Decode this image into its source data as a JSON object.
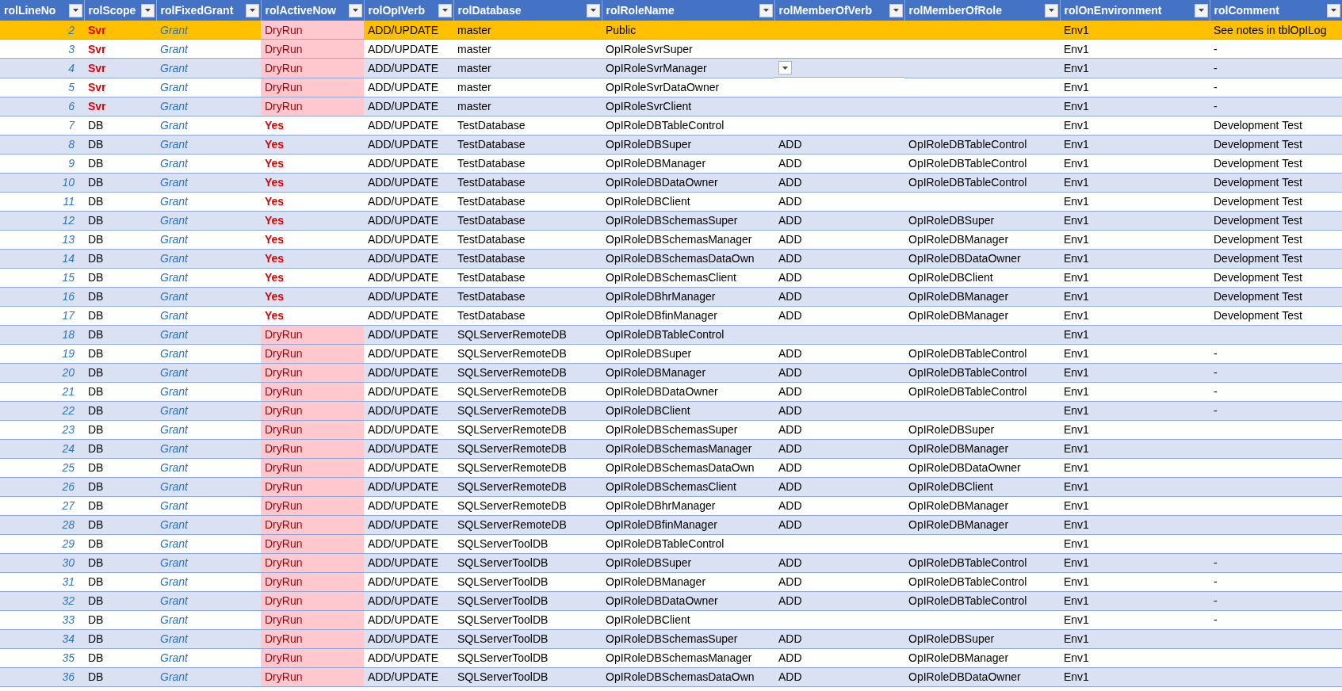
{
  "table": {
    "columns": [
      "rolLineNo",
      "rolScope",
      "rolFixedGrant",
      "rolActiveNow",
      "rolOpIVerb",
      "rolDatabase",
      "rolRoleName",
      "rolMemberOfVerb",
      "rolMemberOfRole",
      "rolOnEnvironment",
      "rolComment"
    ],
    "rows": [
      {
        "line_no": "2",
        "scope": "Svr",
        "scope_emphasis": true,
        "fixed_grant": "Grant",
        "active_now": "DryRun",
        "dry_run": true,
        "opi_verb": "ADD/UPDATE",
        "database": "master",
        "role_name": "Public",
        "on_environment": "Env1",
        "comment": "See notes in tblOpILog",
        "selected": true
      },
      {
        "line_no": "3",
        "scope": "Svr",
        "scope_emphasis": true,
        "fixed_grant": "Grant",
        "active_now": "DryRun",
        "dry_run": true,
        "opi_verb": "ADD/UPDATE",
        "database": "master",
        "role_name": "OpIRoleSvrSuper",
        "on_environment": "Env1",
        "comment": "-",
        "selected": false
      },
      {
        "line_no": "4",
        "scope": "Svr",
        "scope_emphasis": true,
        "fixed_grant": "Grant",
        "active_now": "DryRun",
        "dry_run": true,
        "opi_verb": "ADD/UPDATE",
        "database": "master",
        "role_name": "OpIRoleSvrManager",
        "dropdown_shown": true,
        "on_environment": "Env1",
        "comment": "-",
        "selected": false
      },
      {
        "line_no": "5",
        "scope": "Svr",
        "scope_emphasis": true,
        "fixed_grant": "Grant",
        "active_now": "DryRun",
        "dry_run": true,
        "opi_verb": "ADD/UPDATE",
        "database": "master",
        "role_name": "OpIRoleSvrDataOwner",
        "on_environment": "Env1",
        "comment": "-",
        "selected": false
      },
      {
        "line_no": "6",
        "scope": "Svr",
        "scope_emphasis": true,
        "fixed_grant": "Grant",
        "active_now": "DryRun",
        "dry_run": true,
        "opi_verb": "ADD/UPDATE",
        "database": "master",
        "role_name": "OpIRoleSvrClient",
        "on_environment": "Env1",
        "comment": "-",
        "selected": false
      },
      {
        "line_no": "7",
        "scope": "DB",
        "scope_emphasis": false,
        "fixed_grant": "Grant",
        "active_now": "Yes",
        "dry_run": false,
        "opi_verb": "ADD/UPDATE",
        "database": "TestDatabase",
        "role_name": "OpIRoleDBTableControl",
        "on_environment": "Env1",
        "comment": "Development Test",
        "selected": false
      },
      {
        "line_no": "8",
        "scope": "DB",
        "scope_emphasis": false,
        "fixed_grant": "Grant",
        "active_now": "Yes",
        "dry_run": false,
        "opi_verb": "ADD/UPDATE",
        "database": "TestDatabase",
        "role_name": "OpIRoleDBSuper",
        "member_of_verb": "ADD",
        "member_of_role": "OpIRoleDBTableControl",
        "on_environment": "Env1",
        "comment": "Development Test",
        "selected": false
      },
      {
        "line_no": "9",
        "scope": "DB",
        "scope_emphasis": false,
        "fixed_grant": "Grant",
        "active_now": "Yes",
        "dry_run": false,
        "opi_verb": "ADD/UPDATE",
        "database": "TestDatabase",
        "role_name": "OpIRoleDBManager",
        "member_of_verb": "ADD",
        "member_of_role": "OpIRoleDBTableControl",
        "on_environment": "Env1",
        "comment": "Development Test",
        "selected": false
      },
      {
        "line_no": "10",
        "scope": "DB",
        "scope_emphasis": false,
        "fixed_grant": "Grant",
        "active_now": "Yes",
        "dry_run": false,
        "opi_verb": "ADD/UPDATE",
        "database": "TestDatabase",
        "role_name": "OpIRoleDBDataOwner",
        "member_of_verb": "ADD",
        "member_of_role": "OpIRoleDBTableControl",
        "on_environment": "Env1",
        "comment": "Development Test",
        "selected": false
      },
      {
        "line_no": "11",
        "scope": "DB",
        "scope_emphasis": false,
        "fixed_grant": "Grant",
        "active_now": "Yes",
        "dry_run": false,
        "opi_verb": "ADD/UPDATE",
        "database": "TestDatabase",
        "role_name": "OpIRoleDBClient",
        "member_of_verb": "ADD",
        "on_environment": "Env1",
        "comment": "Development Test",
        "selected": false
      },
      {
        "line_no": "12",
        "scope": "DB",
        "scope_emphasis": false,
        "fixed_grant": "Grant",
        "active_now": "Yes",
        "dry_run": false,
        "opi_verb": "ADD/UPDATE",
        "database": "TestDatabase",
        "role_name": "OpIRoleDBSchemasSuper",
        "member_of_verb": "ADD",
        "member_of_role": "OpIRoleDBSuper",
        "on_environment": "Env1",
        "comment": "Development Test",
        "selected": false
      },
      {
        "line_no": "13",
        "scope": "DB",
        "scope_emphasis": false,
        "fixed_grant": "Grant",
        "active_now": "Yes",
        "dry_run": false,
        "opi_verb": "ADD/UPDATE",
        "database": "TestDatabase",
        "role_name": "OpIRoleDBSchemasManager",
        "member_of_verb": "ADD",
        "member_of_role": "OpIRoleDBManager",
        "on_environment": "Env1",
        "comment": "Development Test",
        "selected": false
      },
      {
        "line_no": "14",
        "scope": "DB",
        "scope_emphasis": false,
        "fixed_grant": "Grant",
        "active_now": "Yes",
        "dry_run": false,
        "opi_verb": "ADD/UPDATE",
        "database": "TestDatabase",
        "role_name": "OpIRoleDBSchemasDataOwn",
        "member_of_verb": "ADD",
        "member_of_role": "OpIRoleDBDataOwner",
        "on_environment": "Env1",
        "comment": "Development Test",
        "selected": false
      },
      {
        "line_no": "15",
        "scope": "DB",
        "scope_emphasis": false,
        "fixed_grant": "Grant",
        "active_now": "Yes",
        "dry_run": false,
        "opi_verb": "ADD/UPDATE",
        "database": "TestDatabase",
        "role_name": "OpIRoleDBSchemasClient",
        "member_of_verb": "ADD",
        "member_of_role": "OpIRoleDBClient",
        "on_environment": "Env1",
        "comment": "Development Test",
        "selected": false
      },
      {
        "line_no": "16",
        "scope": "DB",
        "scope_emphasis": false,
        "fixed_grant": "Grant",
        "active_now": "Yes",
        "dry_run": false,
        "opi_verb": "ADD/UPDATE",
        "database": "TestDatabase",
        "role_name": "OpIRoleDBhrManager",
        "member_of_verb": "ADD",
        "member_of_role": "OpIRoleDBManager",
        "on_environment": "Env1",
        "comment": "Development Test",
        "selected": false
      },
      {
        "line_no": "17",
        "scope": "DB",
        "scope_emphasis": false,
        "fixed_grant": "Grant",
        "active_now": "Yes",
        "dry_run": false,
        "opi_verb": "ADD/UPDATE",
        "database": "TestDatabase",
        "role_name": "OpIRoleDBfinManager",
        "member_of_verb": "ADD",
        "member_of_role": "OpIRoleDBManager",
        "on_environment": "Env1",
        "comment": "Development Test",
        "selected": false
      },
      {
        "line_no": "18",
        "scope": "DB",
        "scope_emphasis": false,
        "fixed_grant": "Grant",
        "active_now": "DryRun",
        "dry_run": true,
        "opi_verb": "ADD/UPDATE",
        "database": "SQLServerRemoteDB",
        "role_name": "OpIRoleDBTableControl",
        "on_environment": "Env1",
        "selected": false
      },
      {
        "line_no": "19",
        "scope": "DB",
        "scope_emphasis": false,
        "fixed_grant": "Grant",
        "active_now": "DryRun",
        "dry_run": true,
        "opi_verb": "ADD/UPDATE",
        "database": "SQLServerRemoteDB",
        "role_name": "OpIRoleDBSuper",
        "member_of_verb": "ADD",
        "member_of_role": "OpIRoleDBTableControl",
        "on_environment": "Env1",
        "comment": "-",
        "selected": false
      },
      {
        "line_no": "20",
        "scope": "DB",
        "scope_emphasis": false,
        "fixed_grant": "Grant",
        "active_now": "DryRun",
        "dry_run": true,
        "opi_verb": "ADD/UPDATE",
        "database": "SQLServerRemoteDB",
        "role_name": "OpIRoleDBManager",
        "member_of_verb": "ADD",
        "member_of_role": "OpIRoleDBTableControl",
        "on_environment": "Env1",
        "comment": "-",
        "selected": false
      },
      {
        "line_no": "21",
        "scope": "DB",
        "scope_emphasis": false,
        "fixed_grant": "Grant",
        "active_now": "DryRun",
        "dry_run": true,
        "opi_verb": "ADD/UPDATE",
        "database": "SQLServerRemoteDB",
        "role_name": "OpIRoleDBDataOwner",
        "member_of_verb": "ADD",
        "member_of_role": "OpIRoleDBTableControl",
        "on_environment": "Env1",
        "comment": "-",
        "selected": false
      },
      {
        "line_no": "22",
        "scope": "DB",
        "scope_emphasis": false,
        "fixed_grant": "Grant",
        "active_now": "DryRun",
        "dry_run": true,
        "opi_verb": "ADD/UPDATE",
        "database": "SQLServerRemoteDB",
        "role_name": "OpIRoleDBClient",
        "member_of_verb": "ADD",
        "on_environment": "Env1",
        "comment": "-",
        "selected": false
      },
      {
        "line_no": "23",
        "scope": "DB",
        "scope_emphasis": false,
        "fixed_grant": "Grant",
        "active_now": "DryRun",
        "dry_run": true,
        "opi_verb": "ADD/UPDATE",
        "database": "SQLServerRemoteDB",
        "role_name": "OpIRoleDBSchemasSuper",
        "member_of_verb": "ADD",
        "member_of_role": "OpIRoleDBSuper",
        "on_environment": "Env1",
        "selected": false
      },
      {
        "line_no": "24",
        "scope": "DB",
        "scope_emphasis": false,
        "fixed_grant": "Grant",
        "active_now": "DryRun",
        "dry_run": true,
        "opi_verb": "ADD/UPDATE",
        "database": "SQLServerRemoteDB",
        "role_name": "OpIRoleDBSchemasManager",
        "member_of_verb": "ADD",
        "member_of_role": "OpIRoleDBManager",
        "on_environment": "Env1",
        "selected": false
      },
      {
        "line_no": "25",
        "scope": "DB",
        "scope_emphasis": false,
        "fixed_grant": "Grant",
        "active_now": "DryRun",
        "dry_run": true,
        "opi_verb": "ADD/UPDATE",
        "database": "SQLServerRemoteDB",
        "role_name": "OpIRoleDBSchemasDataOwn",
        "member_of_verb": "ADD",
        "member_of_role": "OpIRoleDBDataOwner",
        "on_environment": "Env1",
        "selected": false
      },
      {
        "line_no": "26",
        "scope": "DB",
        "scope_emphasis": false,
        "fixed_grant": "Grant",
        "active_now": "DryRun",
        "dry_run": true,
        "opi_verb": "ADD/UPDATE",
        "database": "SQLServerRemoteDB",
        "role_name": "OpIRoleDBSchemasClient",
        "member_of_verb": "ADD",
        "member_of_role": "OpIRoleDBClient",
        "on_environment": "Env1",
        "selected": false
      },
      {
        "line_no": "27",
        "scope": "DB",
        "scope_emphasis": false,
        "fixed_grant": "Grant",
        "active_now": "DryRun",
        "dry_run": true,
        "opi_verb": "ADD/UPDATE",
        "database": "SQLServerRemoteDB",
        "role_name": "OpIRoleDBhrManager",
        "member_of_verb": "ADD",
        "member_of_role": "OpIRoleDBManager",
        "on_environment": "Env1",
        "selected": false
      },
      {
        "line_no": "28",
        "scope": "DB",
        "scope_emphasis": false,
        "fixed_grant": "Grant",
        "active_now": "DryRun",
        "dry_run": true,
        "opi_verb": "ADD/UPDATE",
        "database": "SQLServerRemoteDB",
        "role_name": "OpIRoleDBfinManager",
        "member_of_verb": "ADD",
        "member_of_role": "OpIRoleDBManager",
        "on_environment": "Env1",
        "selected": false
      },
      {
        "line_no": "29",
        "scope": "DB",
        "scope_emphasis": false,
        "fixed_grant": "Grant",
        "active_now": "DryRun",
        "dry_run": true,
        "opi_verb": "ADD/UPDATE",
        "database": "SQLServerToolDB",
        "role_name": "OpIRoleDBTableControl",
        "on_environment": "Env1",
        "selected": false
      },
      {
        "line_no": "30",
        "scope": "DB",
        "scope_emphasis": false,
        "fixed_grant": "Grant",
        "active_now": "DryRun",
        "dry_run": true,
        "opi_verb": "ADD/UPDATE",
        "database": "SQLServerToolDB",
        "role_name": "OpIRoleDBSuper",
        "member_of_verb": "ADD",
        "member_of_role": "OpIRoleDBTableControl",
        "on_environment": "Env1",
        "comment": "-",
        "selected": false
      },
      {
        "line_no": "31",
        "scope": "DB",
        "scope_emphasis": false,
        "fixed_grant": "Grant",
        "active_now": "DryRun",
        "dry_run": true,
        "opi_verb": "ADD/UPDATE",
        "database": "SQLServerToolDB",
        "role_name": "OpIRoleDBManager",
        "member_of_verb": "ADD",
        "member_of_role": "OpIRoleDBTableControl",
        "on_environment": "Env1",
        "comment": "-",
        "selected": false
      },
      {
        "line_no": "32",
        "scope": "DB",
        "scope_emphasis": false,
        "fixed_grant": "Grant",
        "active_now": "DryRun",
        "dry_run": true,
        "opi_verb": "ADD/UPDATE",
        "database": "SQLServerToolDB",
        "role_name": "OpIRoleDBDataOwner",
        "member_of_verb": "ADD",
        "member_of_role": "OpIRoleDBTableControl",
        "on_environment": "Env1",
        "comment": "-",
        "selected": false
      },
      {
        "line_no": "33",
        "scope": "DB",
        "scope_emphasis": false,
        "fixed_grant": "Grant",
        "active_now": "DryRun",
        "dry_run": true,
        "opi_verb": "ADD/UPDATE",
        "database": "SQLServerToolDB",
        "role_name": "OpIRoleDBClient",
        "on_environment": "Env1",
        "comment": "-",
        "selected": false
      },
      {
        "line_no": "34",
        "scope": "DB",
        "scope_emphasis": false,
        "fixed_grant": "Grant",
        "active_now": "DryRun",
        "dry_run": true,
        "opi_verb": "ADD/UPDATE",
        "database": "SQLServerToolDB",
        "role_name": "OpIRoleDBSchemasSuper",
        "member_of_verb": "ADD",
        "member_of_role": "OpIRoleDBSuper",
        "on_environment": "Env1",
        "selected": false
      },
      {
        "line_no": "35",
        "scope": "DB",
        "scope_emphasis": false,
        "fixed_grant": "Grant",
        "active_now": "DryRun",
        "dry_run": true,
        "opi_verb": "ADD/UPDATE",
        "database": "SQLServerToolDB",
        "role_name": "OpIRoleDBSchemasManager",
        "member_of_verb": "ADD",
        "member_of_role": "OpIRoleDBManager",
        "on_environment": "Env1",
        "selected": false
      },
      {
        "line_no": "36",
        "scope": "DB",
        "scope_emphasis": false,
        "fixed_grant": "Grant",
        "active_now": "DryRun",
        "dry_run": true,
        "opi_verb": "ADD/UPDATE",
        "database": "SQLServerToolDB",
        "role_name": "OpIRoleDBSchemasDataOwn",
        "member_of_verb": "ADD",
        "member_of_role": "OpIRoleDBDataOwner",
        "on_environment": "Env1",
        "selected": false
      }
    ]
  }
}
